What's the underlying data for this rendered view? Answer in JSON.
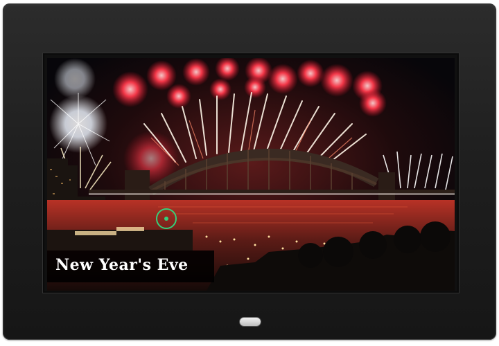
{
  "photo_frame": {
    "caption": "New Year's Eve"
  },
  "scene": {
    "subject": "fireworks-over-harbour-bridge-photo",
    "colors": {
      "sky": "#07060a",
      "fireworks_red": "#e8324a",
      "fireworks_white": "#fff4e6",
      "water_glow": "#c23a2c"
    }
  },
  "icons": {
    "power": "power-button"
  }
}
